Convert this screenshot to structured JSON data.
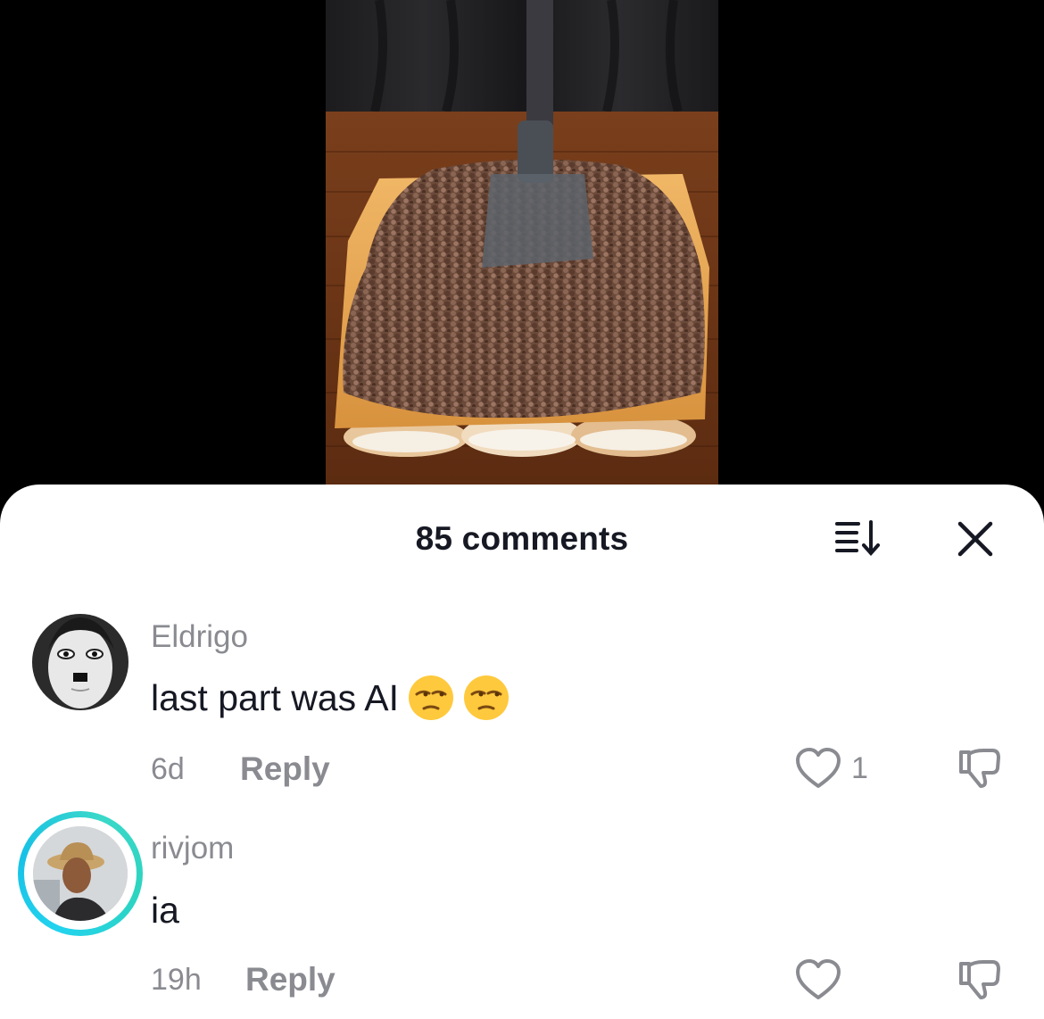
{
  "video": {
    "description_icon": "video-frame"
  },
  "sheet": {
    "title": "85 comments",
    "sort_icon": "sort-icon",
    "close_icon": "close-icon"
  },
  "comments": [
    {
      "username": "Eldrigo",
      "text": "last part was AI",
      "emoji": [
        "unamused-face",
        "unamused-face"
      ],
      "time": "6d",
      "reply_label": "Reply",
      "like_count": "1",
      "has_story_ring": false
    },
    {
      "username": "rivjom",
      "text": "ia",
      "emoji": [],
      "time": "19h",
      "reply_label": "Reply",
      "like_count": "",
      "has_story_ring": true
    }
  ],
  "colors": {
    "text_primary": "#161823",
    "text_secondary": "#8a8b91",
    "story_ring": "#22d3ee"
  }
}
